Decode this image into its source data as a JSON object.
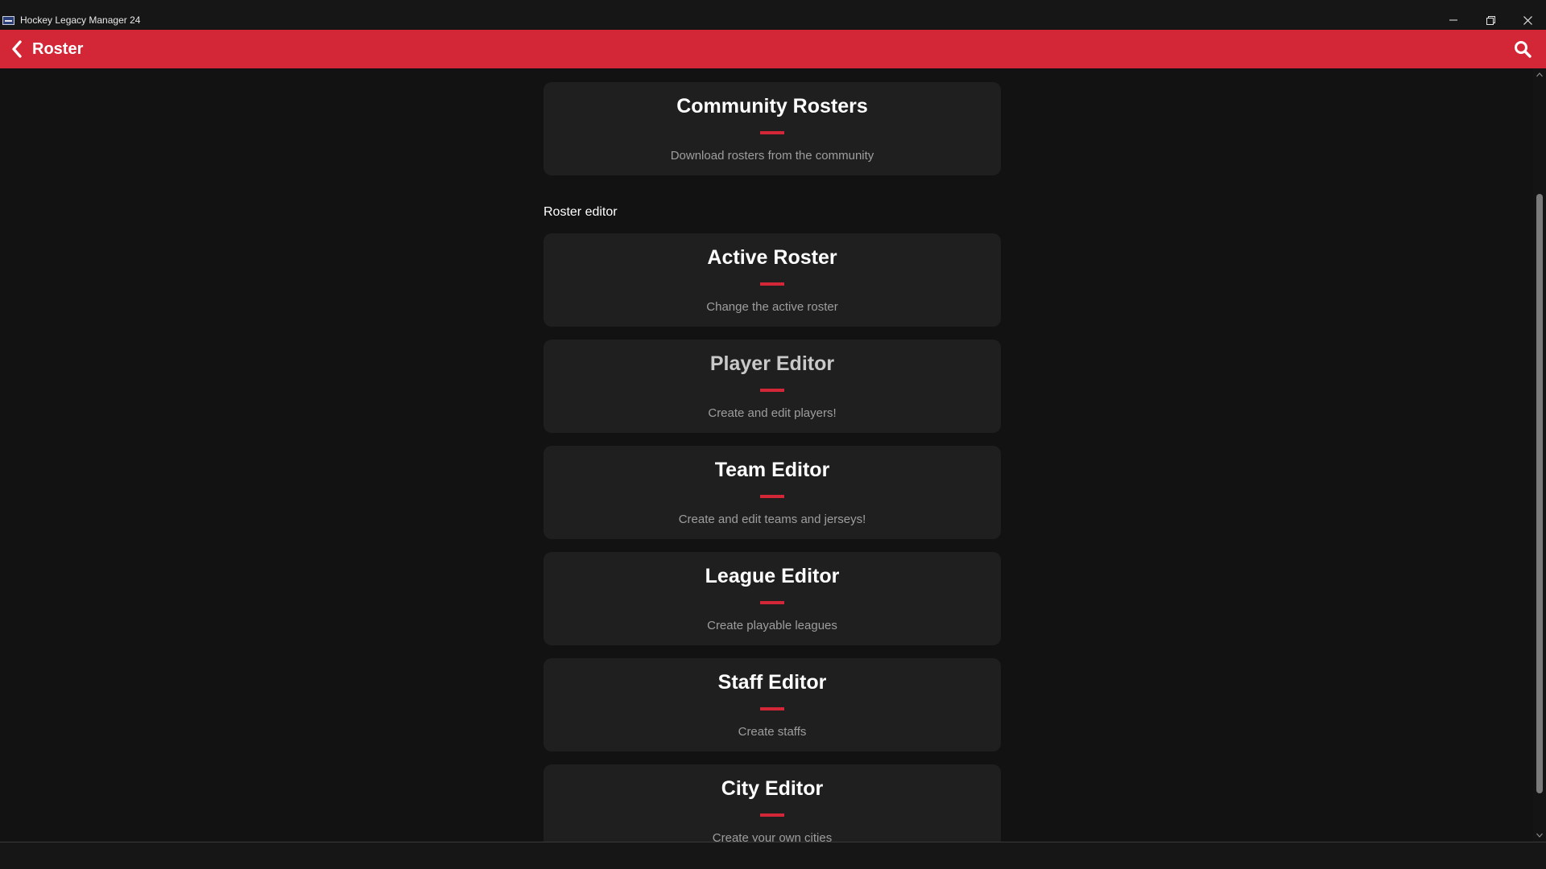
{
  "window": {
    "title": "Hockey Legacy Manager 24",
    "controls": [
      "minimize",
      "restore",
      "close"
    ]
  },
  "appbar": {
    "title": "Roster",
    "back_icon": "chevron-left-icon",
    "search_icon": "search-icon",
    "accent_color": "#d32636"
  },
  "community": {
    "title": "Community Rosters",
    "description": "Download rosters from the community"
  },
  "section": {
    "label": "Roster editor"
  },
  "cards": [
    {
      "title": "Active Roster",
      "description": "Change the active roster"
    },
    {
      "title": "Player Editor",
      "description": "Create and edit players!"
    },
    {
      "title": "Team Editor",
      "description": "Create and edit teams and jerseys!"
    },
    {
      "title": "League Editor",
      "description": "Create playable leagues"
    },
    {
      "title": "Staff Editor",
      "description": "Create staffs"
    },
    {
      "title": "City Editor",
      "description": "Create your own cities"
    }
  ]
}
